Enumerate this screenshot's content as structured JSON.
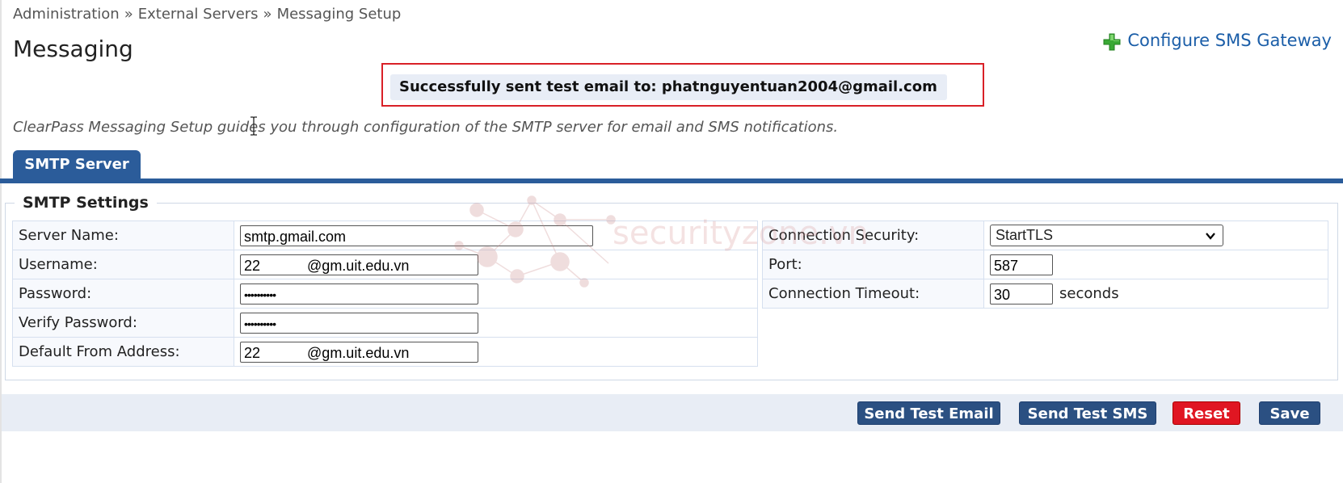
{
  "breadcrumb": [
    "Administration",
    "External Servers",
    "Messaging Setup"
  ],
  "breadcrumb_separator": "»",
  "page_title": "Messaging",
  "config_link": {
    "label": "Configure SMS Gateway",
    "icon": "plus-icon",
    "color": "#1b5ea8"
  },
  "success_message": "Successfully sent test email to: phatnguyentuan2004@gmail.com",
  "description": "ClearPass Messaging Setup guides you through configuration of the SMTP server for email and SMS notifications.",
  "tabs": [
    {
      "label": "SMTP Server",
      "active": true
    }
  ],
  "smtp": {
    "legend": "SMTP Settings",
    "server_name": {
      "label": "Server Name:",
      "value": "smtp.gmail.com"
    },
    "username": {
      "label": "Username:",
      "prefix": "22",
      "suffix": "@gm.uit.edu.vn"
    },
    "password": {
      "label": "Password:",
      "value": "••••••••••"
    },
    "verify_password": {
      "label": "Verify Password:",
      "value": "••••••••••"
    },
    "default_from": {
      "label": "Default From Address:",
      "prefix": "22",
      "suffix": "@gm.uit.edu.vn"
    },
    "connection_security": {
      "label": "Connection Security:",
      "value": "StartTLS"
    },
    "port": {
      "label": "Port:",
      "value": "587"
    },
    "timeout": {
      "label": "Connection Timeout:",
      "value": "30",
      "unit": "seconds"
    }
  },
  "watermark": "securityzone.vn",
  "buttons": {
    "send_test_email": "Send Test Email",
    "send_test_sms": "Send Test SMS",
    "reset": "Reset",
    "save": "Save"
  },
  "colors": {
    "accent": "#2b5c9a",
    "button": "#2b5082",
    "reset": "#e01622",
    "highlight_border": "#d92027"
  }
}
